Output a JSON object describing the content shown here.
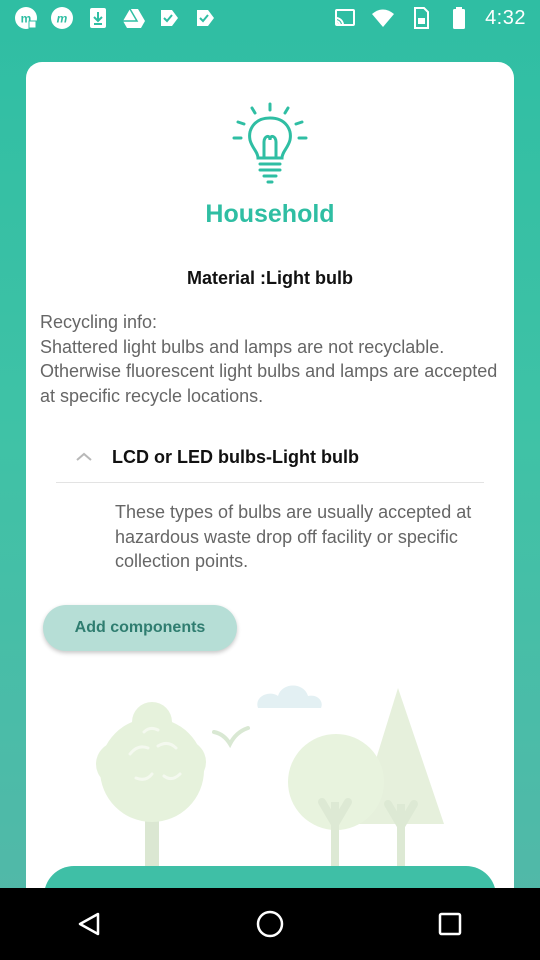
{
  "status_bar": {
    "time": "4:32",
    "left_icons": [
      "m-notification-icon",
      "m-circle-notification-icon",
      "download-icon",
      "drive-icon",
      "flag-check-icon",
      "flag-check-icon"
    ],
    "right_icons": [
      "cast-icon",
      "wifi-icon",
      "sim-card-icon",
      "battery-icon"
    ]
  },
  "card": {
    "category_icon": "light-bulb-icon",
    "category": "Household",
    "material": "Material :Light bulb",
    "recycling_info_label": "Recycling info:",
    "recycling_info_text": "Shattered light bulbs and lamps are not recyclable. Otherwise fluorescent light bulbs and lamps are accepted at specific recycle locations.",
    "component": {
      "title": "LCD or LED bulbs-Light bulb",
      "expanded": true,
      "description": "These types of bulbs are usually accepted at hazardous waste drop off facility or specific collection points."
    },
    "add_button_label": "Add components"
  },
  "colors": {
    "accent": "#2fbea3",
    "button_bg": "#b6ded6",
    "button_text": "#2f7d70",
    "illustration_green": "#e6f2dc"
  },
  "nav_bar": [
    "back-icon",
    "home-icon",
    "recents-icon"
  ]
}
